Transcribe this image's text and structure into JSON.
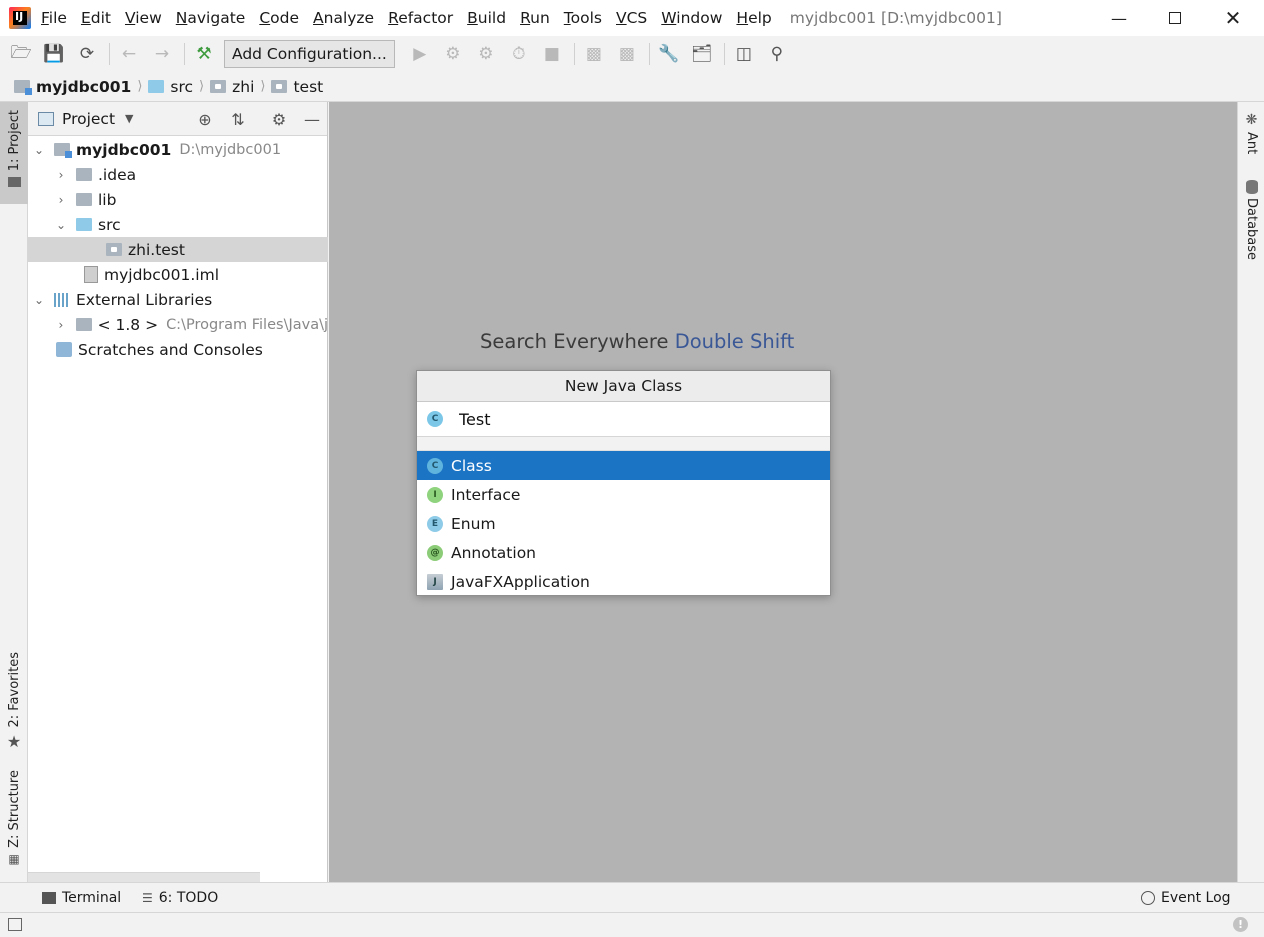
{
  "menu": {
    "items": [
      "File",
      "Edit",
      "View",
      "Navigate",
      "Code",
      "Analyze",
      "Refactor",
      "Build",
      "Run",
      "Tools",
      "VCS",
      "Window",
      "Help"
    ],
    "window_title": "myjdbc001 [D:\\myjdbc001]"
  },
  "toolbar": {
    "add_configuration_label": "Add Configuration..."
  },
  "breadcrumb": {
    "items": [
      "myjdbc001",
      "src",
      "zhi",
      "test"
    ]
  },
  "left_stripe": {
    "project_tab": "1: Project",
    "favorites_tab": "2: Favorites",
    "structure_tab": "Z: Structure"
  },
  "project_panel": {
    "title": "Project",
    "tree": {
      "root_name": "myjdbc001",
      "root_path": "D:\\myjdbc001",
      "idea": ".idea",
      "lib": "lib",
      "src": "src",
      "package": "zhi.test",
      "iml": "myjdbc001.iml",
      "external_libraries": "External Libraries",
      "jdk_name": "< 1.8 >",
      "jdk_path": "C:\\Program Files\\Java\\j",
      "scratches": "Scratches and Consoles"
    }
  },
  "editor": {
    "hint_text": "Search Everywhere",
    "hint_key": "Double Shift"
  },
  "right_stripe": {
    "ant_tab": "Ant",
    "database_tab": "Database"
  },
  "popup": {
    "title": "New Java Class",
    "name_value": "Test",
    "kinds": [
      {
        "label": "Class",
        "icon": "C"
      },
      {
        "label": "Interface",
        "icon": "I"
      },
      {
        "label": "Enum",
        "icon": "E"
      },
      {
        "label": "Annotation",
        "icon": "@"
      },
      {
        "label": "JavaFXApplication",
        "icon": "J"
      }
    ],
    "selected_kind": "Class"
  },
  "bottom_bar": {
    "terminal": "Terminal",
    "todo": "6: TODO",
    "event_log": "Event Log"
  }
}
